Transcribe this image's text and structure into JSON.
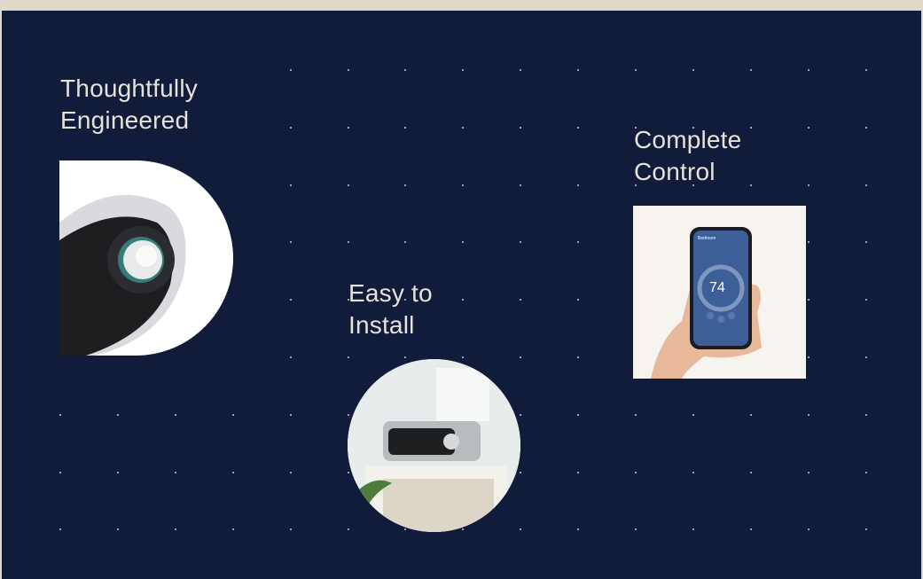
{
  "features": [
    {
      "title_line1": "Thoughtfully",
      "title_line2": "Engineered",
      "image": "air-conditioner-dial-closeup"
    },
    {
      "title_line1": "Easy to",
      "title_line2": "Install",
      "image": "window-unit-installed"
    },
    {
      "title_line1": "Complete",
      "title_line2": "Control",
      "image": "phone-app-hand"
    }
  ],
  "phone_app": {
    "room": "Bedroom",
    "temperature": "74"
  },
  "colors": {
    "background": "#111c3b",
    "top_bar": "#e2d8ca",
    "text": "#e6e2da",
    "dot": "#c9cbd6",
    "app_blue": "#3d5f98"
  }
}
